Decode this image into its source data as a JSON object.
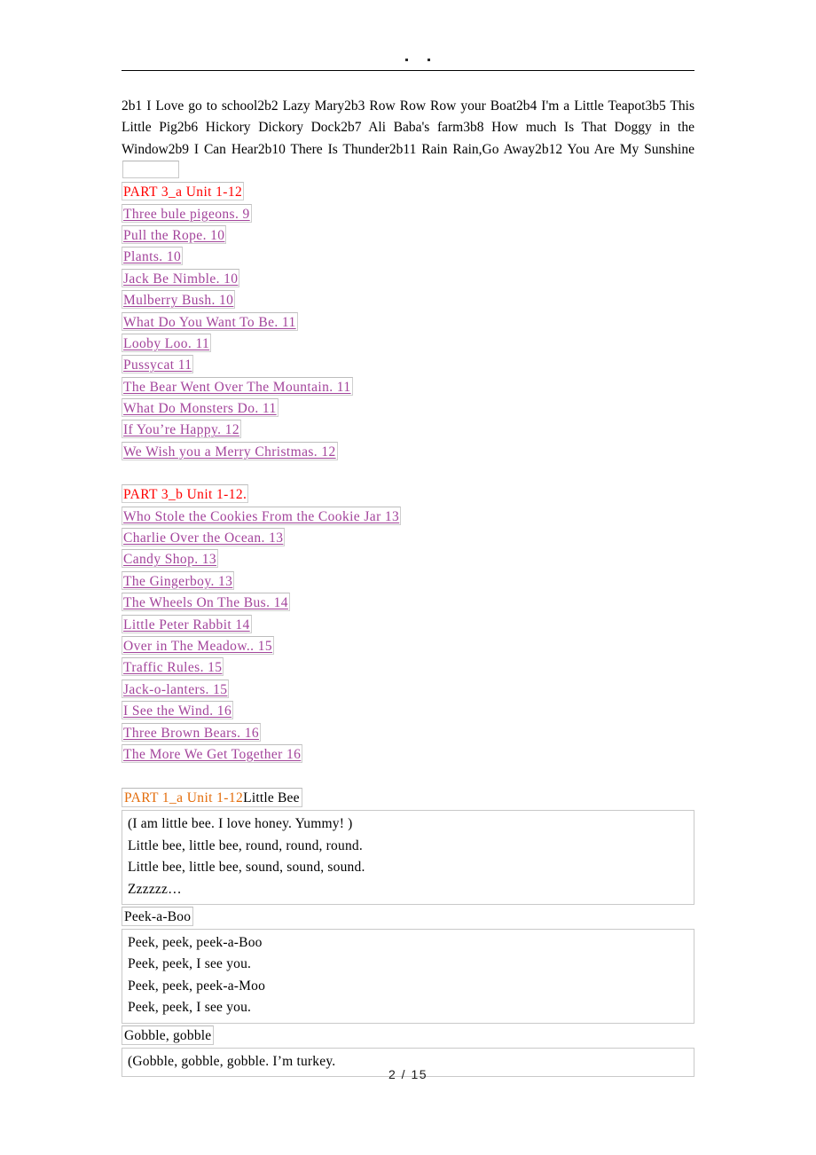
{
  "document": {
    "header_marks": [
      "dot",
      "dot"
    ],
    "footer": "2 / 15"
  },
  "intro": {
    "text": "2b1 I Love go to school2b2 Lazy Mary2b3 Row Row Row your Boat2b4 I'm a Little Teapot3b5 This Little Pig2b6 Hickory Dickory Dock2b7 Ali Baba's farm3b8 How much Is That Doggy in the Window2b9 I Can Hear2b10 There Is Thunder2b11 Rain Rain,Go Away2b12 You Are My Sunshine"
  },
  "toc": {
    "sections": [
      {
        "heading": "PART 3_a Unit 1-12",
        "entries": [
          "Three bule pigeons.  9",
          "Pull the Rope.  10",
          "Plants.  10",
          "Jack Be Nimble.  10",
          "Mulberry Bush.  10",
          "What Do You Want To Be.  11",
          "Looby Loo.  11",
          "Pussycat   11",
          "The Bear Went Over The Mountain.  11",
          "What Do Monsters Do.  11",
          "If You’re Happy.  12",
          "We Wish you a Merry Christmas.  12"
        ]
      },
      {
        "heading": "PART 3_b Unit 1-12.",
        "entries": [
          "Who Stole the Cookies From the Cookie Jar   13",
          "Charlie Over the Ocean.  13",
          "Candy Shop.  13",
          "The Gingerboy.  13",
          "The Wheels On The Bus.  14",
          "Little Peter Rabbit   14",
          "Over in The Meadow..  15",
          "Traffic Rules.  15",
          "Jack-o-lanters.  15",
          "I See the Wind.  16",
          "Three Brown Bears.  16",
          "The More We Get Together   16"
        ]
      }
    ]
  },
  "songs": [
    {
      "part_tag": "PART 1_a Unit 1-12",
      "name": "Little Bee",
      "lines": [
        "(I am little bee.  I love honey.  Yummy! )",
        "Little bee, little bee, round, round, round.",
        "Little bee, little bee, sound, sound, sound.",
        "Zzzzzz…"
      ]
    },
    {
      "part_tag": "",
      "name": "Peek-a-Boo",
      "lines": [
        "Peek, peek, peek-a-Boo",
        "Peek, peek, I see you.",
        "Peek, peek, peek-a-Moo",
        "Peek, peek, I see you."
      ]
    },
    {
      "part_tag": "",
      "name": "Gobble, gobble",
      "lines": [
        "(Gobble, gobble, gobble. I’m turkey."
      ]
    }
  ],
  "colors": {
    "toc_heading": "#ff0000",
    "toc_link": "#a3449b",
    "part_tag": "#e36c0a",
    "body_text": "#000000",
    "field_border": "#c9c9c9"
  }
}
